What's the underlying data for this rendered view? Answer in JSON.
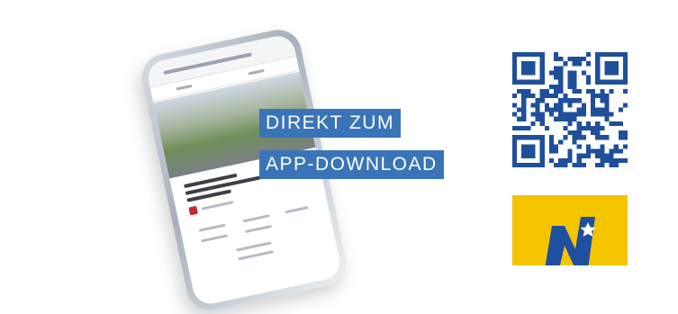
{
  "headline": {
    "line1": "DIREKT ZUM",
    "line2": "APP-DOWNLOAD"
  },
  "colors": {
    "label_bg": "#3a74b8",
    "label_text": "#ffffff",
    "qr": "#1f4f9a",
    "logo_bg": "#f5c400",
    "logo_mark": "#1e4fa0"
  },
  "icons": {
    "phone": "smartphone-mockup",
    "qr": "qr-code",
    "logo": "noe-logo"
  }
}
